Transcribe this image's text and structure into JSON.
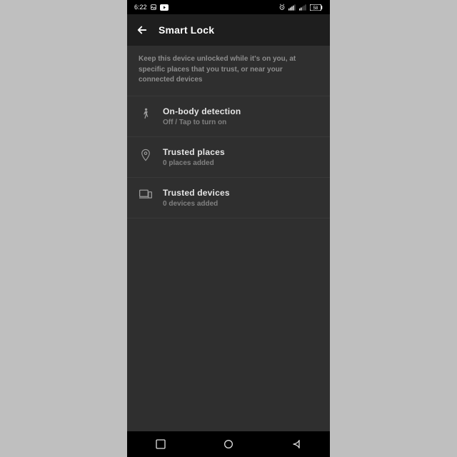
{
  "statusbar": {
    "time": "6:22"
  },
  "header": {
    "title": "Smart Lock"
  },
  "description": "Keep this device unlocked while it's on you, at specific places that you trust, or near your connected devices",
  "items": [
    {
      "title": "On-body detection",
      "subtitle": "Off / Tap to turn on"
    },
    {
      "title": "Trusted places",
      "subtitle": "0 places added"
    },
    {
      "title": "Trusted devices",
      "subtitle": "0 devices added"
    }
  ]
}
